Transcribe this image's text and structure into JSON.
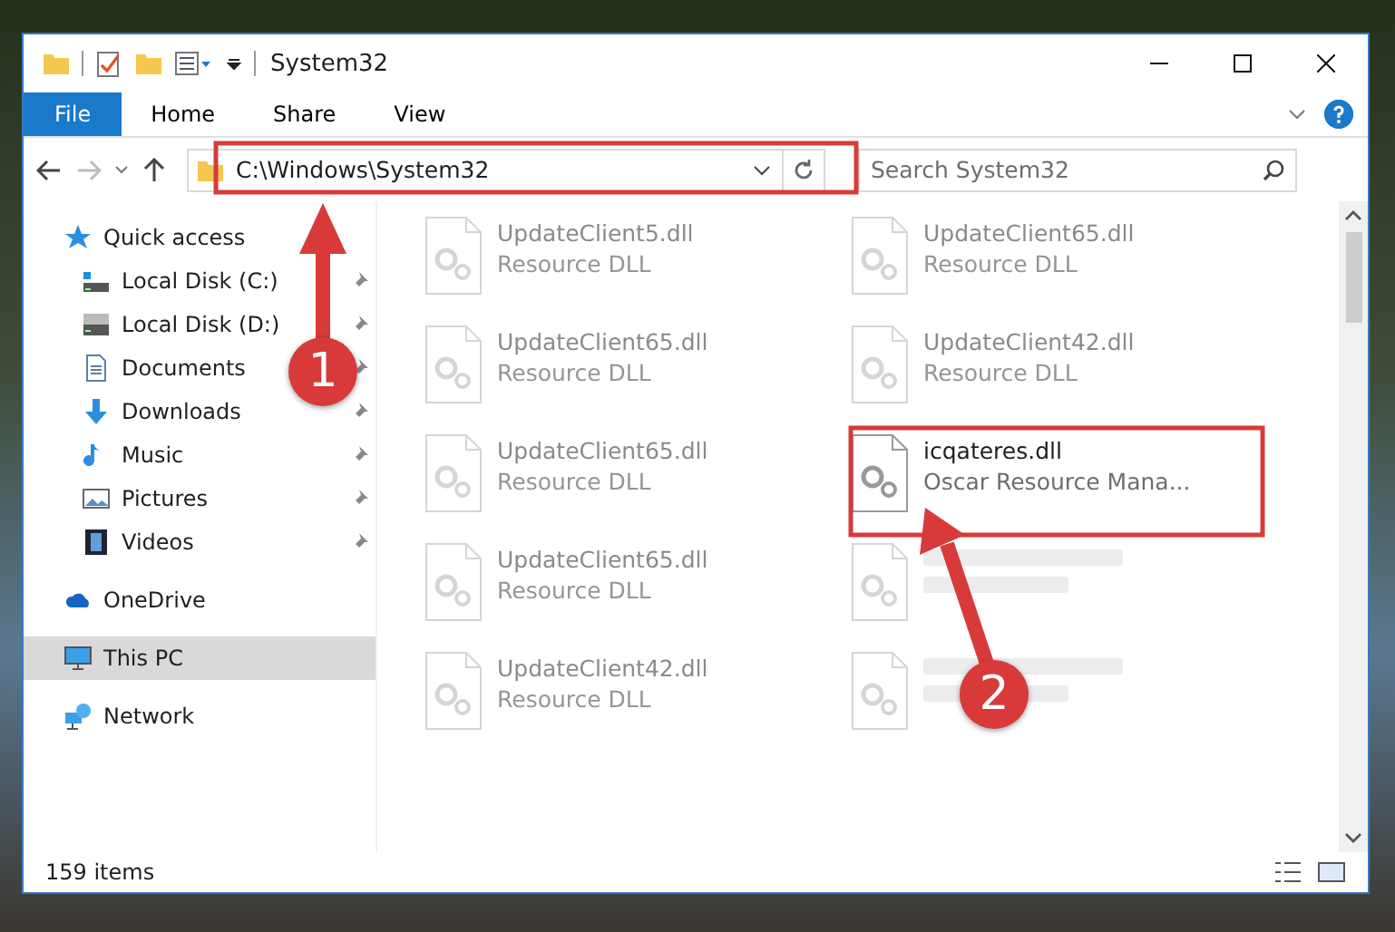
{
  "window": {
    "title": "System32"
  },
  "ribbon_tabs": [
    {
      "label": "File",
      "kind": "menu"
    },
    {
      "label": "Home",
      "kind": "tab"
    },
    {
      "label": "Share",
      "kind": "tab"
    },
    {
      "label": "View",
      "kind": "tab"
    }
  ],
  "address_bar": {
    "path": "C:\\Windows\\System32"
  },
  "search": {
    "placeholder": "Search System32"
  },
  "sidebar": {
    "items": [
      {
        "label": "Quick access",
        "selected": false,
        "children": [
          {
            "label": "Local Disk (C:)",
            "selected": false,
            "pinned": true
          },
          {
            "label": "Local Disk (D:)",
            "selected": false,
            "pinned": true
          },
          {
            "label": "Documents",
            "selected": false,
            "pinned": true
          },
          {
            "label": "Downloads",
            "selected": false,
            "pinned": true
          },
          {
            "label": "Music",
            "selected": false,
            "pinned": true
          },
          {
            "label": "Pictures",
            "selected": false,
            "pinned": true
          },
          {
            "label": "Videos",
            "selected": false,
            "pinned": true
          }
        ]
      },
      {
        "label": "OneDrive",
        "selected": false
      },
      {
        "label": "This PC",
        "selected": true
      },
      {
        "label": "Network",
        "selected": false
      }
    ]
  },
  "files": [
    {
      "name": "UpdateClient5.dll",
      "description": "Resource DLL",
      "blurred": true
    },
    {
      "name": "UpdateClient65.dll",
      "description": "Resource DLL",
      "blurred": true
    },
    {
      "name": "UpdateClient65.dll",
      "description": "Resource DLL",
      "blurred": true
    },
    {
      "name": "UpdateClient42.dll",
      "description": "Resource DLL",
      "blurred": true
    },
    {
      "name": "UpdateClient65.dll",
      "description": "Resource DLL",
      "blurred": true
    },
    {
      "name": "icqateres.dll",
      "description": "Oscar Resource Mana...",
      "blurred": false
    },
    {
      "name": "UpdateClient65.dll",
      "description": "Resource DLL",
      "blurred": true
    },
    {
      "blurred": true
    },
    {
      "name": "UpdateClient42.dll",
      "description": "Resource DLL",
      "blurred": true
    },
    {
      "blurred": true
    }
  ],
  "status_bar": {
    "item_count": "159 items"
  },
  "annotations": [
    {
      "number": "1"
    },
    {
      "number": "2"
    }
  ]
}
